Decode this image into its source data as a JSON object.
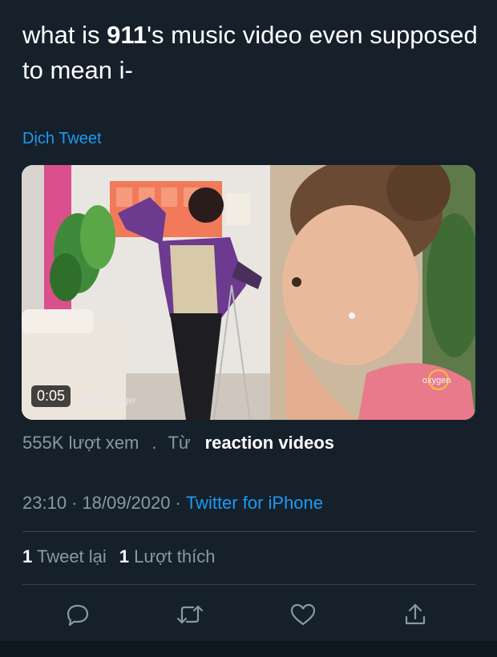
{
  "tweet": {
    "text_before": "what is ",
    "text_bold": "911",
    "text_after": "'s music video even supposed to mean i-",
    "translate_label": "Dịch Tweet"
  },
  "media": {
    "duration": "0:05",
    "watermark": "@BGCBlogger",
    "channel_logo": "oxygen"
  },
  "stats": {
    "views": "555K lượt xem",
    "dot": ".",
    "from_label": "Từ",
    "source": "reaction videos"
  },
  "meta": {
    "time": "23:10",
    "separator": "·",
    "date": "18/09/2020",
    "client": "Twitter for iPhone"
  },
  "counts": {
    "retweets": "1",
    "retweets_label": "Tweet lại",
    "likes": "1",
    "likes_label": "Lượt thích"
  },
  "actions": [
    {
      "icon": "reply-icon"
    },
    {
      "icon": "retweet-icon"
    },
    {
      "icon": "like-icon"
    },
    {
      "icon": "share-icon"
    }
  ],
  "colors": {
    "background": "#15202b",
    "accent": "#1d9bf0",
    "secondary_text": "#8899a6",
    "divider": "#38444d"
  }
}
